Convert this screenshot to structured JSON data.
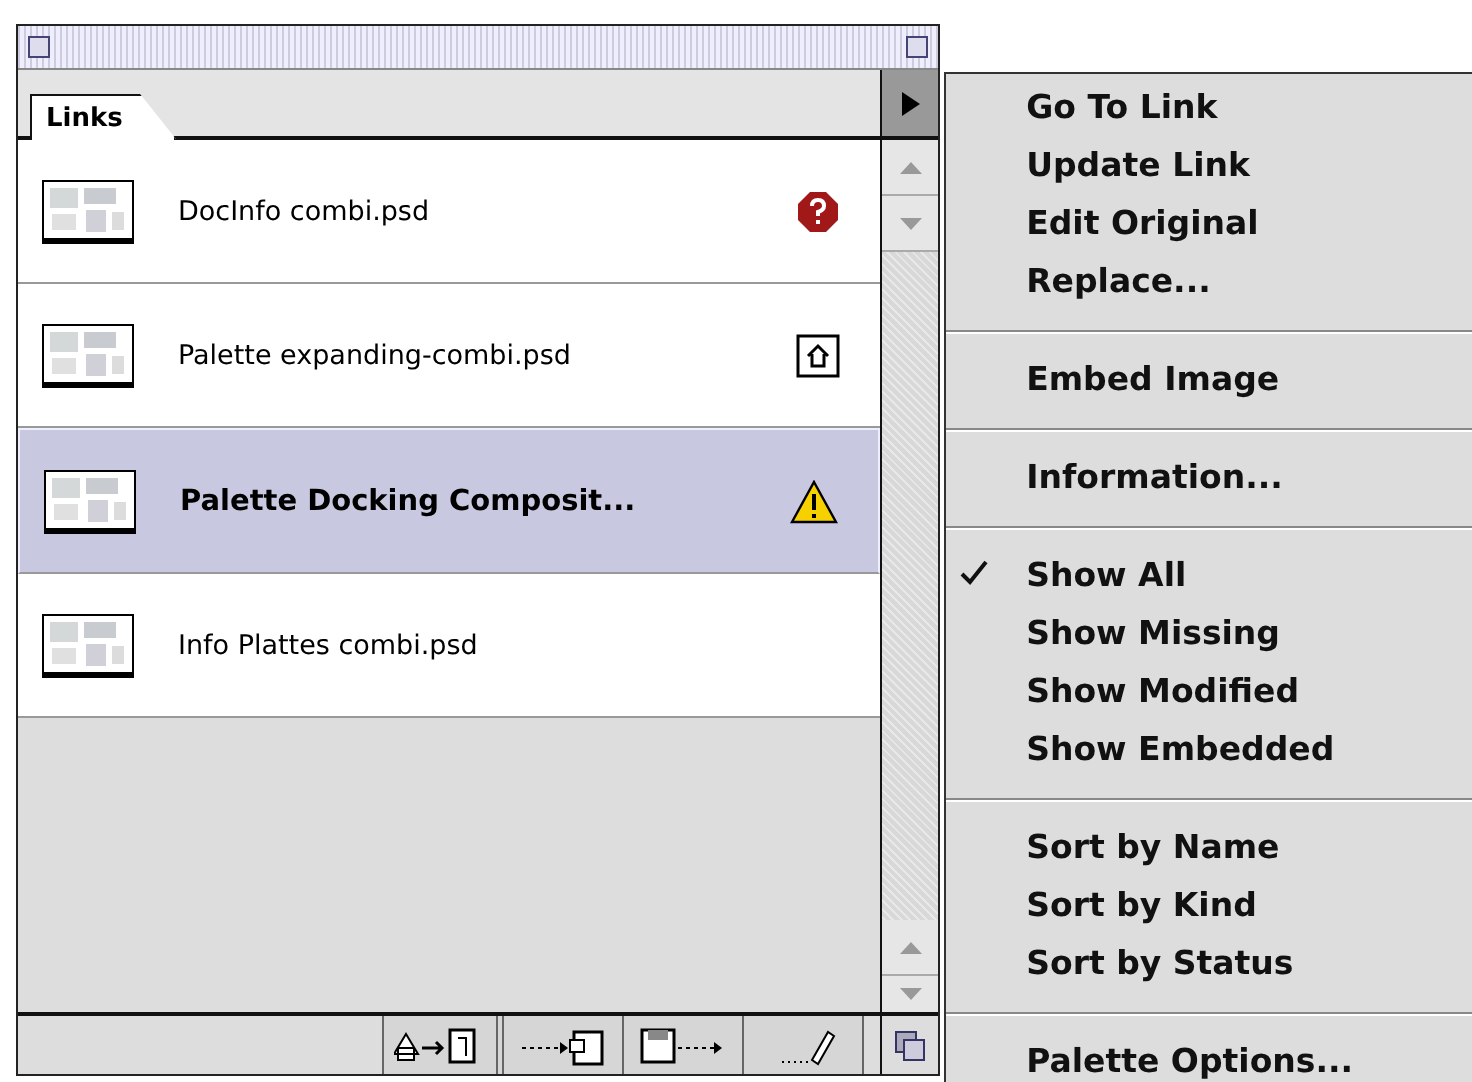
{
  "palette": {
    "tab": {
      "label": "Links",
      "selected": true
    },
    "rows": [
      {
        "name": "DocInfo combi.psd",
        "kind": "missing",
        "selected": false
      },
      {
        "name": "Palette expanding-combi.psd",
        "kind": "modified",
        "selected": false
      },
      {
        "name": "Palette Docking Composit...",
        "kind": "warning",
        "selected": true
      },
      {
        "name": "Info Plattes combi.psd",
        "kind": "none",
        "selected": false
      }
    ]
  },
  "menu": {
    "groups": [
      [
        {
          "label": "Go To Link",
          "checked": false
        },
        {
          "label": "Update Link",
          "checked": false
        },
        {
          "label": "Edit Original",
          "checked": false
        },
        {
          "label": "Replace...",
          "checked": false
        }
      ],
      [
        {
          "label": "Embed Image",
          "checked": false
        }
      ],
      [
        {
          "label": "Information...",
          "checked": false
        }
      ],
      [
        {
          "label": "Show All",
          "checked": true
        },
        {
          "label": "Show Missing",
          "checked": false
        },
        {
          "label": "Show Modified",
          "checked": false
        },
        {
          "label": "Show Embedded",
          "checked": false
        }
      ],
      [
        {
          "label": "Sort by Name",
          "checked": false
        },
        {
          "label": "Sort by Kind",
          "checked": false
        },
        {
          "label": "Sort by Status",
          "checked": false
        }
      ],
      [
        {
          "label": "Palette Options...",
          "checked": false
        }
      ]
    ]
  }
}
